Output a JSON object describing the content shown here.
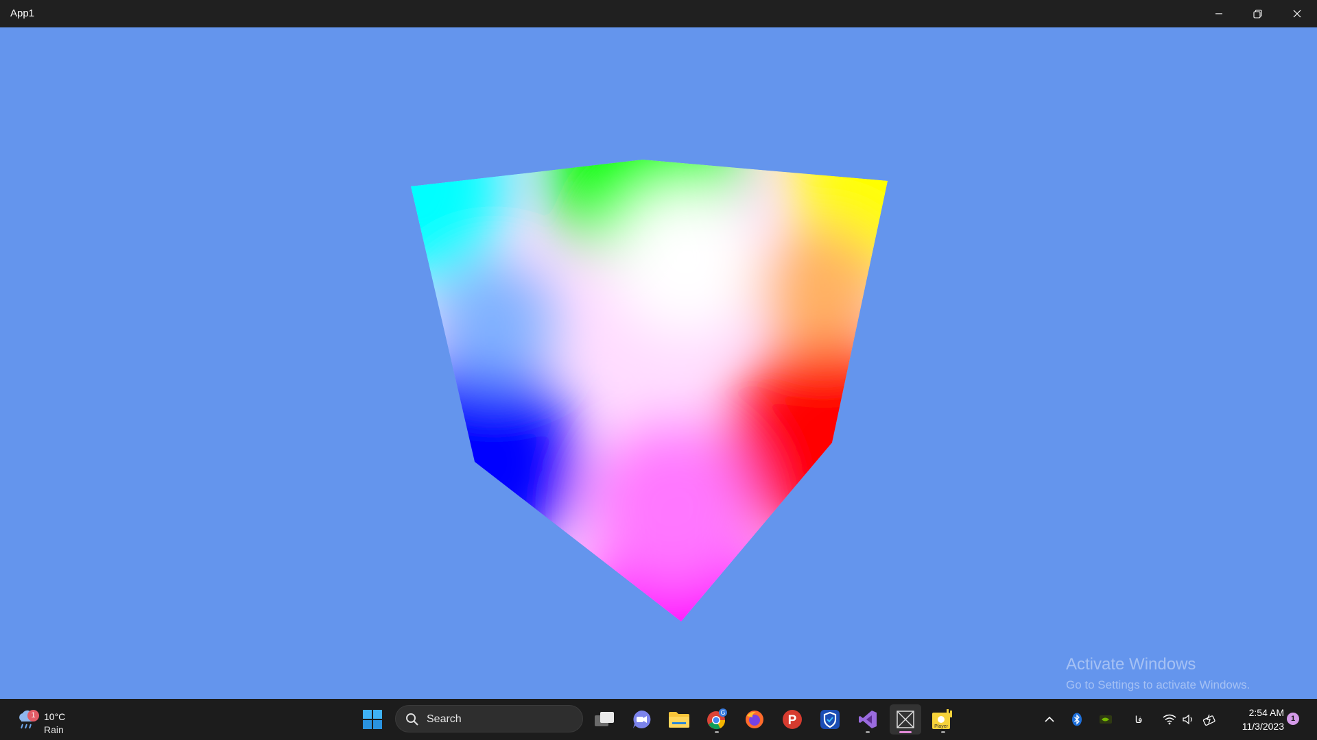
{
  "window": {
    "title": "App1",
    "minimize_icon": "minimize-icon",
    "restore_icon": "restore-icon",
    "close_icon": "close-icon"
  },
  "scene": {
    "background_color": "#6495ED",
    "object": "rgb-color-cube",
    "vertex_colors": {
      "top": "#00FF00",
      "top_left": "#00FFFF",
      "top_right": "#FFFF00",
      "center": "#FFFFFF",
      "left": "#0000FF",
      "right": "#FF0000",
      "bottom": "#FF00FF"
    }
  },
  "watermark": {
    "line1": "Activate Windows",
    "line2": "Go to Settings to activate Windows."
  },
  "taskbar": {
    "weather": {
      "temp": "10°C",
      "condition": "Rain",
      "badge": "1",
      "icon": "rain-cloud-icon"
    },
    "search": {
      "label": "Search",
      "icon": "search-icon"
    },
    "apps": [
      {
        "name": "start",
        "icon": "windows-start-icon"
      },
      {
        "name": "task-view",
        "icon": "task-view-icon"
      },
      {
        "name": "meet",
        "icon": "video-chat-icon"
      },
      {
        "name": "file-explorer",
        "icon": "folder-icon"
      },
      {
        "name": "chrome",
        "icon": "chrome-icon",
        "badge": "G"
      },
      {
        "name": "firefox",
        "icon": "firefox-icon"
      },
      {
        "name": "psiphon",
        "icon": "p-app-icon"
      },
      {
        "name": "vpn",
        "icon": "shield-app-icon"
      },
      {
        "name": "visual-studio",
        "icon": "visual-studio-icon"
      },
      {
        "name": "app1",
        "icon": "app1-window-icon"
      },
      {
        "name": "player",
        "icon": "player-icon",
        "label": "Player"
      }
    ],
    "tray": {
      "chevron_icon": "chevron-up-icon",
      "bluetooth_icon": "bluetooth-icon",
      "nvidia_icon": "nvidia-icon",
      "language": "فا",
      "wifi_icon": "wifi-icon",
      "volume_icon": "volume-icon",
      "battery_icon": "battery-icon"
    },
    "clock": {
      "time": "2:54 AM",
      "date": "11/3/2023"
    },
    "notifications": {
      "count": "1"
    }
  }
}
